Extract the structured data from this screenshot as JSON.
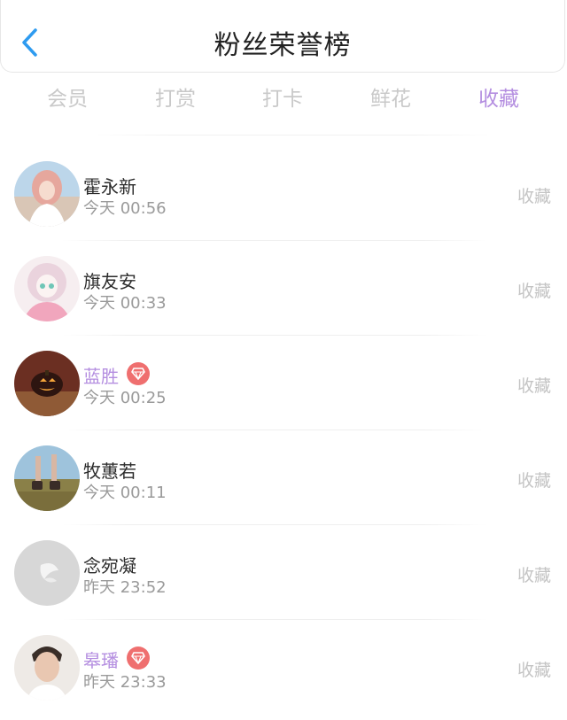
{
  "header": {
    "title": "粉丝荣誉榜"
  },
  "tabs": [
    {
      "label": "会员",
      "active": false
    },
    {
      "label": "打赏",
      "active": false
    },
    {
      "label": "打卡",
      "active": false
    },
    {
      "label": "鲜花",
      "active": false
    },
    {
      "label": "收藏",
      "active": true
    }
  ],
  "accent_color": "#b48ee0",
  "badge_color": "#ef6f6f",
  "fans": [
    {
      "name": "霍永新",
      "time": "今天 00:56",
      "action": "收藏",
      "vip": false,
      "avatar": "girl-beach-avatar"
    },
    {
      "name": "旗友安",
      "time": "今天 00:33",
      "action": "收藏",
      "vip": false,
      "avatar": "anime-girl-avatar"
    },
    {
      "name": "蓝胜",
      "time": "今天 00:25",
      "action": "收藏",
      "vip": true,
      "avatar": "pumpkin-avatar"
    },
    {
      "name": "牧蕙若",
      "time": "今天 00:11",
      "action": "收藏",
      "vip": false,
      "avatar": "boots-field-avatar"
    },
    {
      "name": "念宛凝",
      "time": "昨天 23:52",
      "action": "收藏",
      "vip": false,
      "avatar": "white-butterfly-avatar"
    },
    {
      "name": "皋璠",
      "time": "昨天 23:33",
      "action": "收藏",
      "vip": true,
      "avatar": "man-portrait-avatar"
    }
  ]
}
